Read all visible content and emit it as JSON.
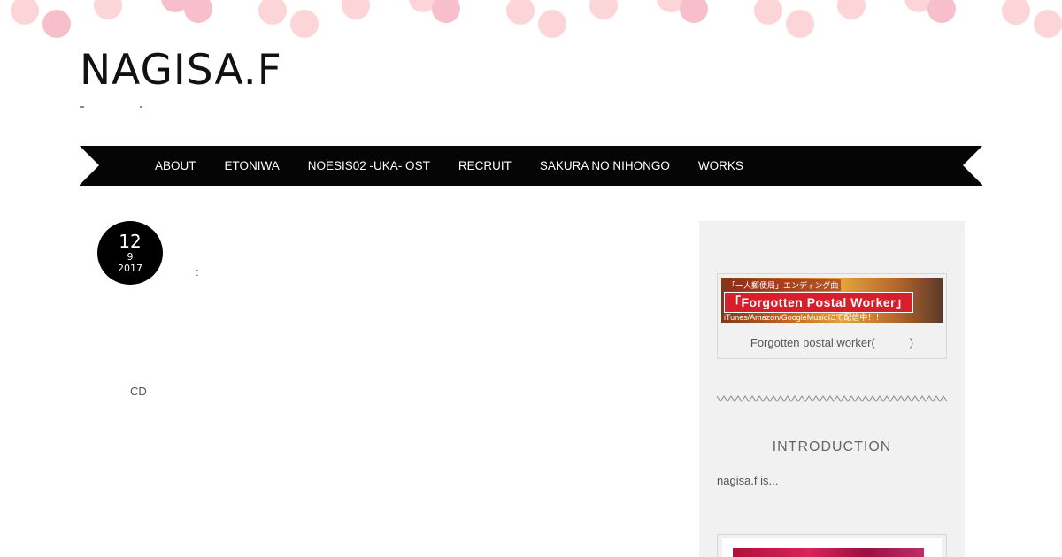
{
  "site": {
    "title": "NAGISA.F"
  },
  "nav": {
    "items": [
      {
        "label": "ABOUT"
      },
      {
        "label": "ETONIWA"
      },
      {
        "label": "NOESIS02 -UKA- OST"
      },
      {
        "label": "RECRUIT"
      },
      {
        "label": "SAKURA NO NIHONGO"
      },
      {
        "label": "WORKS"
      }
    ]
  },
  "post": {
    "date": {
      "day": "12",
      "month": "9",
      "year": "2017"
    },
    "colon": ":",
    "cd_text": "CD"
  },
  "sidebar": {
    "banner": {
      "top_text": "「一人郵便局」エンディング曲",
      "main_text": "「Forgotten Postal Worker」",
      "sub_text": "iTunes/Amazon/GoogleMusicにて配信中！！"
    },
    "banner_caption": "Forgotten postal worker(　　　)",
    "intro_title": "INTRODUCTION",
    "intro_text": "nagisa.f is..."
  },
  "colors": {
    "nav_background": "#050505",
    "sidebar_background": "#f1f1f1",
    "dot_pink": "#fbd5d8"
  }
}
